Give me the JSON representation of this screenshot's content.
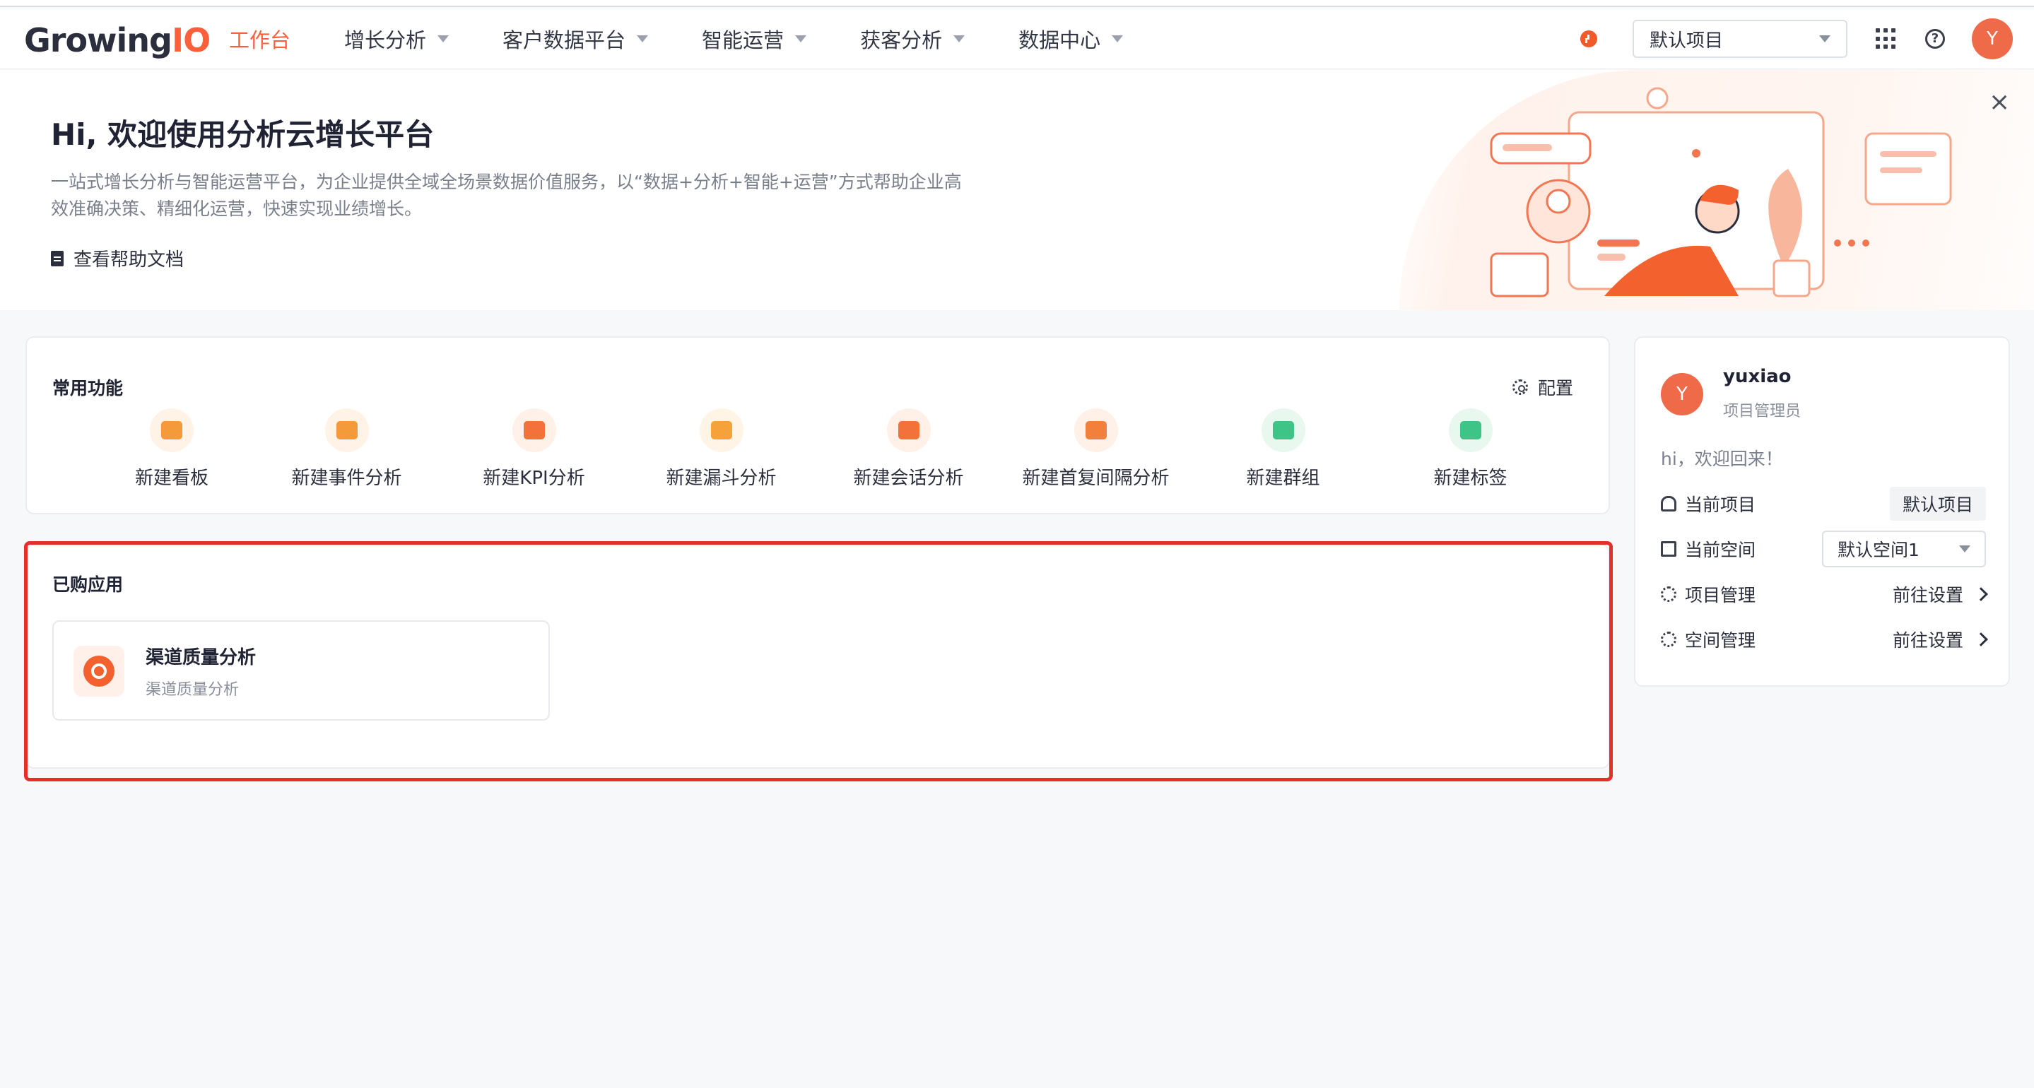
{
  "nav": {
    "logo_main": "Growing",
    "logo_accent": "IO",
    "menu": [
      {
        "label": "工作台"
      },
      {
        "label": "增长分析"
      },
      {
        "label": "客户数据平台"
      },
      {
        "label": "智能运营"
      },
      {
        "label": "获客分析"
      },
      {
        "label": "数据中心"
      }
    ],
    "project_select": "默认项目",
    "avatar_letter": "Y"
  },
  "banner": {
    "title": "Hi, 欢迎使用分析云增长平台",
    "desc": "一站式增长分析与智能运营平台，为企业提供全域全场景数据价值服务，以“数据+分析+智能+运营”方式帮助企业高效准确决策、精细化运营，快速实现业绩增长。",
    "help_doc": "查看帮助文档",
    "close": "×"
  },
  "common": {
    "title": "常用功能",
    "config": "配置",
    "items": [
      {
        "label": "新建看板",
        "icon": "dashboard-icon",
        "color": "#f59a3a",
        "bg": "#fff2e6"
      },
      {
        "label": "新建事件分析",
        "icon": "event-analysis-icon",
        "color": "#f59a3a",
        "bg": "#fff2e6"
      },
      {
        "label": "新建KPI分析",
        "icon": "kpi-analysis-icon",
        "color": "#f3713a",
        "bg": "#fff0e8"
      },
      {
        "label": "新建漏斗分析",
        "icon": "funnel-analysis-icon",
        "color": "#f5a23a",
        "bg": "#fff4e6"
      },
      {
        "label": "新建会话分析",
        "icon": "session-analysis-icon",
        "color": "#f3713a",
        "bg": "#fff0e8"
      },
      {
        "label": "新建首复间隔分析",
        "icon": "interval-analysis-icon",
        "color": "#f3803a",
        "bg": "#fff0e8"
      },
      {
        "label": "新建群组",
        "icon": "group-icon",
        "color": "#3ec486",
        "bg": "#e8f8ef"
      },
      {
        "label": "新建标签",
        "icon": "tag-icon",
        "color": "#3ec486",
        "bg": "#e8f8ef"
      }
    ]
  },
  "purchased": {
    "title": "已购应用",
    "app": {
      "name": "渠道质量分析",
      "sub": "渠道质量分析"
    }
  },
  "user": {
    "avatar_letter": "Y",
    "name": "yuxiao",
    "role": "项目管理员",
    "welcome": "hi，欢迎回来！",
    "current_project_label": "当前项目",
    "current_project_value": "默认项目",
    "current_space_label": "当前空间",
    "current_space_value": "默认空间1",
    "project_mgmt_label": "项目管理",
    "space_mgmt_label": "空间管理",
    "goto_label": "前往设置"
  },
  "colors": {
    "accent": "#fc5f3a",
    "highlight_outline": "#e3302a"
  }
}
